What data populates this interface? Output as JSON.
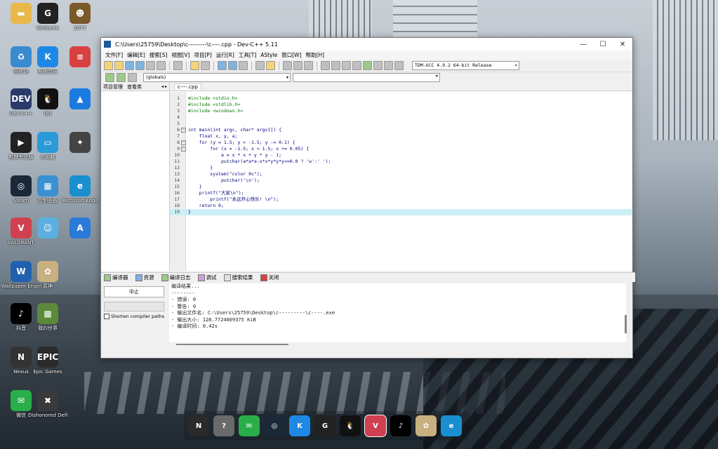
{
  "desktop": {
    "icons": [
      {
        "name": "folder-icon",
        "label": "",
        "color": "#e8b84a",
        "glyph": "▬"
      },
      {
        "name": "wegame-icon",
        "label": "WeGame",
        "color": "#222222",
        "glyph": "G"
      },
      {
        "name": "game-2077-icon",
        "label": "2077",
        "color": "#7a5a2a",
        "glyph": "☻"
      },
      {
        "name": "recycle-bin-icon",
        "label": "回收站",
        "color": "#3a8ad0",
        "glyph": "♻"
      },
      {
        "name": "kugou-icon",
        "label": "酷狗音乐",
        "color": "#1e88e5",
        "glyph": "K"
      },
      {
        "name": "app-red-icon",
        "label": "",
        "color": "#d94040",
        "glyph": "≡"
      },
      {
        "name": "devcpp-icon",
        "label": "Dev-C++",
        "color": "#2a3a6a",
        "glyph": "DEV"
      },
      {
        "name": "qq-icon",
        "label": "QQ",
        "color": "#111111",
        "glyph": "🐧"
      },
      {
        "name": "feishu-icon",
        "label": "",
        "color": "#1a7ae0",
        "glyph": "▲"
      },
      {
        "name": "jianying-icon",
        "label": "剪映专业版",
        "color": "#222222",
        "glyph": "▶"
      },
      {
        "name": "computer-icon",
        "label": "此电脑",
        "color": "#2a9ad8",
        "glyph": "▭"
      },
      {
        "name": "game-icon-3",
        "label": "",
        "color": "#444444",
        "glyph": "✦"
      },
      {
        "name": "steam-icon",
        "label": "Steam",
        "color": "#1b2838",
        "glyph": "◎"
      },
      {
        "name": "control-panel-icon",
        "label": "控制面板",
        "color": "#3a90d0",
        "glyph": "▦"
      },
      {
        "name": "edge-icon",
        "label": "Microsoft Edge",
        "color": "#1a8fd0",
        "glyph": "e"
      },
      {
        "name": "valorant-icon",
        "label": "VALORANT",
        "color": "#d04050",
        "glyph": "V"
      },
      {
        "name": "bilibili-icon",
        "label": "",
        "color": "#5ab0e0",
        "glyph": "☺"
      },
      {
        "name": "app-blue-icon",
        "label": "",
        "color": "#2a7ad8",
        "glyph": "A"
      },
      {
        "name": "wallpaper-engine-icon",
        "label": "Wallpaper Engine",
        "color": "#2060b0",
        "glyph": "W"
      },
      {
        "name": "genshin-icon",
        "label": "原神",
        "color": "#c8b080",
        "glyph": "✿"
      },
      {
        "name": "tiktok-icon",
        "label": "抖音",
        "color": "#000000",
        "glyph": "♪"
      },
      {
        "name": "minecraft-icon",
        "label": "我的世界",
        "color": "#5a8a3a",
        "glyph": "▩"
      },
      {
        "name": "nexus-icon",
        "label": "Nexus",
        "color": "#333333",
        "glyph": "N"
      },
      {
        "name": "epic-icon",
        "label": "Epic Games",
        "color": "#2a2a2a",
        "glyph": "EPIC"
      },
      {
        "name": "wechat-icon",
        "label": "微信",
        "color": "#2aae4a",
        "glyph": "✉"
      },
      {
        "name": "dishonored-icon",
        "label": "Dishonored Definitiv...",
        "color": "#3a3a3a",
        "glyph": "✖"
      }
    ]
  },
  "window": {
    "title": "C:\\Users\\25759\\Desktop\\c---------\\c----.cpp - Dev-C++ 5.11",
    "minimize": "—",
    "maximize": "☐",
    "close": "✕"
  },
  "menu": [
    "文件[F]",
    "编辑[E]",
    "搜索[S]",
    "视图[V]",
    "项目[P]",
    "运行[R]",
    "工具[T]",
    "AStyle",
    "窗口[W]",
    "帮助[H]"
  ],
  "toolbar": {
    "compiler": "TDM-GCC 4.9.2 64-bit Release",
    "globals": "(globals)"
  },
  "left_panel": {
    "tab1": "项目管理",
    "tab2": "查看类",
    "arrows": "◂ ▸"
  },
  "editor": {
    "file_tab": "c----.cpp",
    "lines": [
      {
        "n": "1",
        "text": "#include <stdio.h>"
      },
      {
        "n": "2",
        "text": "#include <stdlib.h>"
      },
      {
        "n": "3",
        "text": "#include <windows.h>"
      },
      {
        "n": "4",
        "text": ""
      },
      {
        "n": "5",
        "text": ""
      },
      {
        "n": "6",
        "text": "int main(int argc, char* argv[]) {"
      },
      {
        "n": "7",
        "text": "    float x, y, a;"
      },
      {
        "n": "8",
        "text": "    for (y = 1.5; y > -1.5; y -= 0.1) {"
      },
      {
        "n": "9",
        "text": "        for (x = -1.5; x < 1.5; x += 0.05) {"
      },
      {
        "n": "10",
        "text": "            a = x * x + y * y - 1;"
      },
      {
        "n": "11",
        "text": "            putchar(a*a*a-x*x*y*y*y<=0.0 ? 'w':' ');"
      },
      {
        "n": "12",
        "text": "        }"
      },
      {
        "n": "13",
        "text": "        system(\"color 0c\");"
      },
      {
        "n": "14",
        "text": "            putchar('\\n');"
      },
      {
        "n": "15",
        "text": "    }"
      },
      {
        "n": "16",
        "text": "    printf(\"大家\\n\");"
      },
      {
        "n": "17",
        "text": "        printf(\"永远开心快乐! \\n\");"
      },
      {
        "n": "18",
        "text": "    return 0;"
      },
      {
        "n": "19",
        "text": "}"
      }
    ]
  },
  "bottom_tabs": [
    "编译器",
    "资源",
    "编译日志",
    "调试",
    "搜索结果",
    "关闭"
  ],
  "bottom_left": {
    "abort": "中止",
    "shorten": "Shorten compiler paths"
  },
  "log": [
    "编译结果...",
    "--------",
    "- 错误: 0",
    "- 警告: 0",
    "- 输出文件名: C:\\Users\\25759\\Desktop\\c---------\\c----.exe",
    "- 输出大小: 128.7724609375 KiB",
    "- 编译时间: 0.42s"
  ],
  "taskbar": [
    {
      "name": "nexus-taskbar-icon",
      "color": "#2a2a2a",
      "glyph": "N"
    },
    {
      "name": "help-taskbar-icon",
      "color": "#6a6a6a",
      "glyph": "?"
    },
    {
      "name": "wechat-taskbar-icon",
      "color": "#2aae4a",
      "glyph": "✉"
    },
    {
      "name": "steam-taskbar-icon",
      "color": "#1b2838",
      "glyph": "◎"
    },
    {
      "name": "kugou-taskbar-icon",
      "color": "#1e88e5",
      "glyph": "K"
    },
    {
      "name": "wegame-taskbar-icon",
      "color": "#222222",
      "glyph": "G"
    },
    {
      "name": "qq-taskbar-icon",
      "color": "#111111",
      "glyph": "🐧"
    },
    {
      "name": "valorant-taskbar-icon",
      "color": "#d04050",
      "glyph": "V"
    },
    {
      "name": "tiktok-taskbar-icon",
      "color": "#000000",
      "glyph": "♪"
    },
    {
      "name": "genshin-taskbar-icon",
      "color": "#c8b080",
      "glyph": "✿"
    },
    {
      "name": "edge-taskbar-icon",
      "color": "#1a8fd0",
      "glyph": "e"
    }
  ]
}
